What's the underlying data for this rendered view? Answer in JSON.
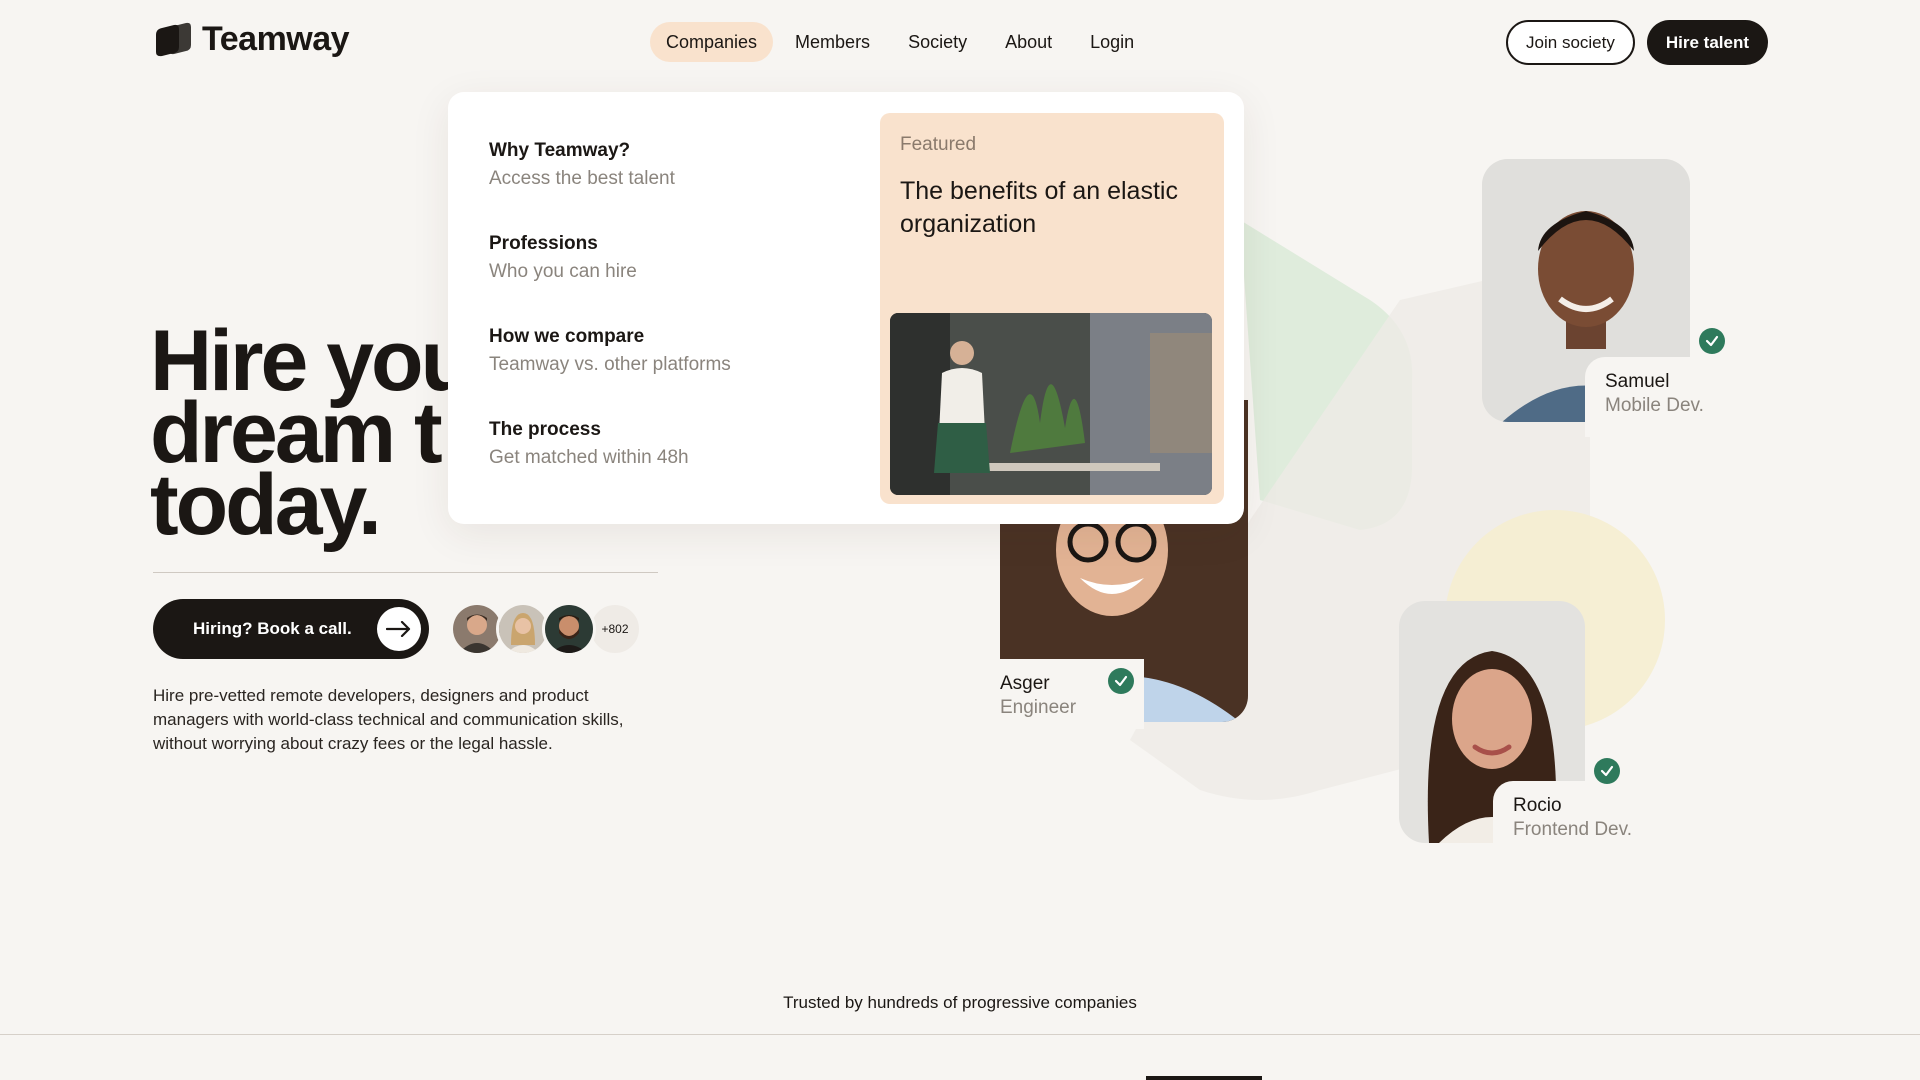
{
  "brand": {
    "name": "Teamway",
    "logo_icon": "teamway-logo-icon"
  },
  "nav": {
    "links": [
      {
        "label": "Companies",
        "active": true
      },
      {
        "label": "Members",
        "active": false
      },
      {
        "label": "Society",
        "active": false
      },
      {
        "label": "About",
        "active": false
      },
      {
        "label": "Login",
        "active": false
      }
    ],
    "join_label": "Join society",
    "hire_label": "Hire talent"
  },
  "hero": {
    "title_line1": "Hire you",
    "title_line2": "dream t",
    "title_line3": "today.",
    "cta_label": "Hiring? Book a call.",
    "member_count": "+802",
    "description": "Hire pre-vetted remote developers, designers and product managers with world-class technical and communication skills, without worrying about crazy fees or the legal hassle."
  },
  "dropdown": {
    "items": [
      {
        "title": "Why Teamway?",
        "subtitle": "Access the best talent"
      },
      {
        "title": "Professions",
        "subtitle": "Who you can hire"
      },
      {
        "title": "How we compare",
        "subtitle": "Teamway vs. other platforms"
      },
      {
        "title": "The process",
        "subtitle": "Get matched within 48h"
      }
    ],
    "featured": {
      "label": "Featured",
      "title": "The benefits of an elastic organization"
    }
  },
  "talent": [
    {
      "name": "Samuel",
      "role": "Mobile Dev."
    },
    {
      "name": "Asger",
      "role": "Engineer"
    },
    {
      "name": "Rocio",
      "role": "Frontend Dev."
    }
  ],
  "trusted": {
    "text": "Trusted by hundreds of progressive companies"
  },
  "colors": {
    "background": "#f7f5f2",
    "dark": "#1b1714",
    "peach": "#f9e2cd",
    "check_green": "#2e7a5c",
    "muted_text": "#8a847d"
  }
}
